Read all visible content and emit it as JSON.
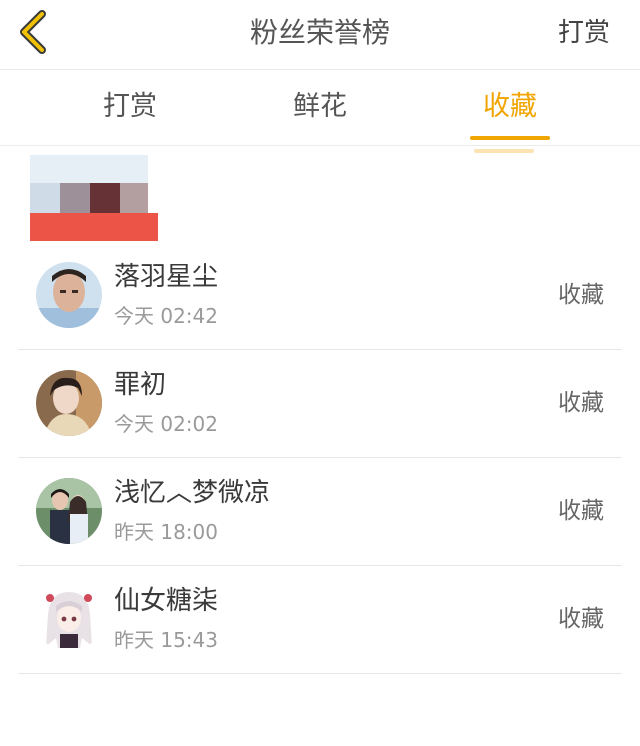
{
  "header": {
    "back_icon": "chevron-left-icon",
    "title": "粉丝荣誉榜",
    "action_label": "打赏"
  },
  "tabs": [
    {
      "label": "打赏",
      "active": false
    },
    {
      "label": "鲜花",
      "active": false
    },
    {
      "label": "收藏",
      "active": true
    }
  ],
  "colors": {
    "accent": "#f0a500",
    "text": "#333333",
    "secondary_text": "#9a9a9a",
    "divider": "#e6e6e6"
  },
  "fans": [
    {
      "name": "落羽星尘",
      "time": "今天 02:42",
      "action": "收藏",
      "avatar": "avatar-photo-boy"
    },
    {
      "name": "罪初",
      "time": "今天 02:02",
      "action": "收藏",
      "avatar": "avatar-photo-girl"
    },
    {
      "name": "浅忆︿梦微凉",
      "time": "昨天 18:00",
      "action": "收藏",
      "avatar": "avatar-photo-couple"
    },
    {
      "name": "仙女糖柒",
      "time": "昨天 15:43",
      "action": "收藏",
      "avatar": "avatar-anime-girl"
    }
  ]
}
